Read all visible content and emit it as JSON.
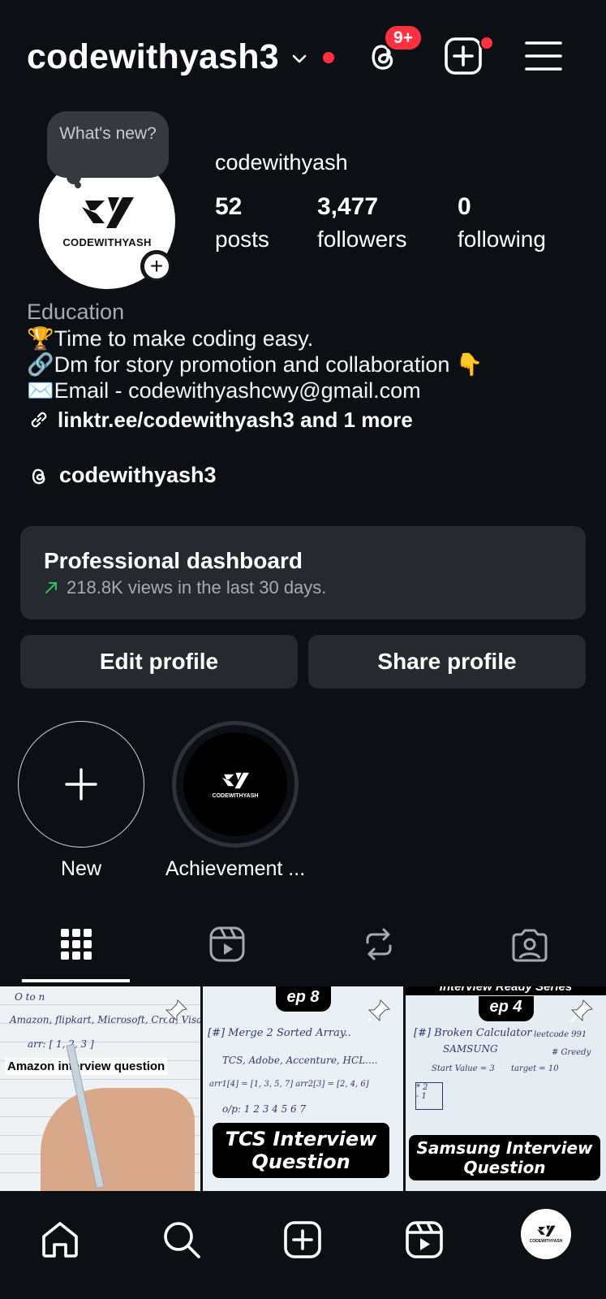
{
  "header": {
    "username": "codewithyash3",
    "threads_badge": "9+"
  },
  "note": {
    "text": "What's new?"
  },
  "profile": {
    "avatar_text": "CODEWITHYASH",
    "display_name": "codewithyash",
    "stats": [
      {
        "value": "52",
        "label": "posts"
      },
      {
        "value": "3,477",
        "label": "followers"
      },
      {
        "value": "0",
        "label": "following"
      }
    ]
  },
  "bio": {
    "category": "Education",
    "lines": [
      "🏆Time to make coding easy.",
      "🔗Dm for story promotion and collaboration 👇",
      "✉️Email - codewithyashcwy@gmail.com"
    ],
    "link": "linktr.ee/codewithyash3 and 1 more",
    "threads_handle": "codewithyash3"
  },
  "dashboard": {
    "title": "Professional dashboard",
    "subtitle": "218.8K views in the last 30 days."
  },
  "buttons": {
    "edit": "Edit profile",
    "share": "Share profile"
  },
  "highlights": [
    {
      "label": "New"
    },
    {
      "label": "Achievement ...",
      "avatar_text": "CODEWITHYASH"
    }
  ],
  "posts": [
    {
      "caption": "Amazon interview question",
      "notes": [
        "O to n",
        "Amazon, flipkart, Microsoft, Cred, Visa",
        "arr: [ 1, 2, 3 ]"
      ]
    },
    {
      "episode": "ep 8",
      "caption": "TCS Interview Question",
      "notes": [
        "[#] Merge 2 Sorted Array..",
        "TCS, Adobe, Accenture, HCL....",
        "arr1[4] = [1, 3, 5, 7]   arr2[3] = [2, 4, 6]",
        "o/p: 1 2 3 4 5 6 7"
      ]
    },
    {
      "series": "Interview Ready Series",
      "episode": "ep 4",
      "caption": "Samsung Interview Question",
      "notes": [
        "[#] Broken Calculator",
        "leetcode 991",
        "SAMSUNG",
        "# Greedy",
        "Start Value = 3",
        "target = 10",
        "* 2",
        "- 1"
      ]
    }
  ],
  "colors": {
    "background": "#0c0f14",
    "card": "#26292f",
    "notification_red": "#ff3040",
    "trend_green": "#2fc15b"
  }
}
